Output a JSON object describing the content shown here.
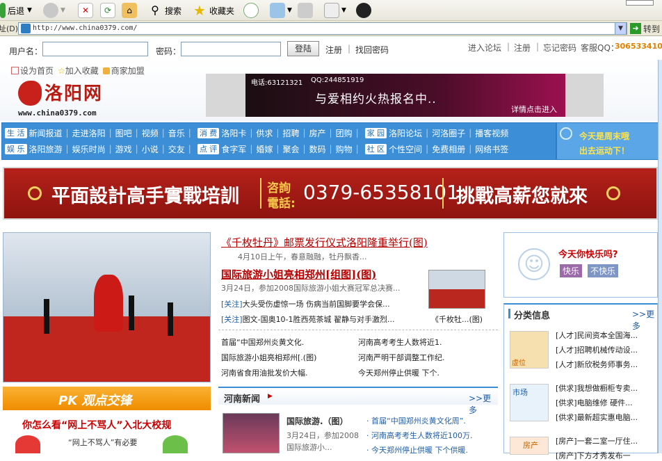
{
  "browser": {
    "back_label": "后退",
    "search_label": "搜索",
    "favorites_label": "收藏夹",
    "address_label": "址(D)",
    "url": "http://www.china0379.com/",
    "go_label": "转到"
  },
  "login": {
    "username_label": "用户名：",
    "password_label": "密码：",
    "login_button": "登陆",
    "register": "注册",
    "find_password": "找回密码",
    "forum": "进入论坛",
    "register2": "注册",
    "forgot": "忘记密码",
    "service_label": "客服QQ：",
    "service_qq": "306533410"
  },
  "header": {
    "set_home": "设为首页",
    "add_fav": "加入收藏",
    "merchant": "商家加盟",
    "logo_text": "洛阳网",
    "logo_url": "www.china0379.com",
    "ad_phone": "电话:63121321",
    "ad_qq": "QQ:244851919",
    "ad_title": "与爱相约火热报名中..",
    "ad_cta": "详情点击进入"
  },
  "nav": {
    "row1": [
      {
        "tag": "生 活",
        "links": [
          "新闻报道",
          "走进洛阳",
          "图吧",
          "视频",
          "音乐"
        ]
      },
      {
        "tag": "消 费",
        "links": [
          "洛阳卡",
          "供求",
          "招聘",
          "房产",
          "团购"
        ]
      },
      {
        "tag": "家 园",
        "links": [
          "洛阳论坛",
          "河洛圈子",
          "播客视频"
        ]
      }
    ],
    "row2": [
      {
        "tag": "娱 乐",
        "links": [
          "洛阳旅游",
          "娱乐时尚",
          "游戏",
          "小说",
          "交友"
        ]
      },
      {
        "tag": "点 评",
        "links": [
          "食字军",
          "婚嫁",
          "聚会",
          "数码",
          "购物"
        ]
      },
      {
        "tag": "社 区",
        "links": [
          "个性空间",
          "免费相册",
          "网络书签"
        ]
      }
    ],
    "weekend_line1": "今天是周末哦",
    "weekend_line2": "出去运动下！"
  },
  "red_banner": {
    "left": "平面設計高手實戰培訓",
    "consult1": "咨詢",
    "consult2": "電話:",
    "phone": "0379-65358101",
    "right": "挑戰高薪您就來"
  },
  "headline": {
    "title1": "《千枚牡丹》邮票发行仪式洛阳隆重举行(图)",
    "sub1": "4月10日上午，春意融融，牡丹飘香...",
    "title2": "国际旅游小姐亮相郑州[组图](图)",
    "sub2": "3月24日，参加2008国际旅游小姐大赛冠军总决赛...",
    "item1_tag": "[关注]",
    "item1": "大头受伤虚惊一场 伤病当前国脚要学会保...",
    "item2_tag": "[关注]",
    "item2": "图文-国奥10-1胜西苑茶城 翟静与对手激烈...",
    "thumb_caption": "《千枚牡...(图)"
  },
  "mid_list": [
    [
      "首届“中国郑州炎黄文化.",
      "河南高考考生人数将近1."
    ],
    [
      "国际旅游小姐亮相郑州[.(图)",
      "河南严明干部调整工作纪."
    ],
    [
      "河南省食用油批发价大幅.",
      "今天郑州停止供暖 下个."
    ]
  ],
  "henan": {
    "title": "河南新闻",
    "more": ">>更多",
    "feature_title": "国际旅游.（图）",
    "feature_sub1": "3月24日，参加2008",
    "feature_sub2": "国际旅游小...",
    "links": [
      "首届“中国郑州炎黄文化周”.",
      "河南高考考生人数将近100万.",
      "今天郑州停止供暖 下个供暖."
    ]
  },
  "pk": {
    "title": "PK 观点交锋",
    "question": "你怎么看“网上不骂人”入北大校规",
    "desc": "“网上不骂人”有必要"
  },
  "mood": {
    "question": "今天你快乐吗?",
    "happy": "快乐",
    "unhappy": "不快乐"
  },
  "classified": {
    "title": "分类信息",
    "more": ">>更多",
    "g1_label": "虚位",
    "group1": [
      "[人才]民间资本全国海...",
      "[人才]招聘机械传动设...",
      "[人才]新欣税务师事务..."
    ],
    "g2_label": "市场",
    "group2": [
      "[供求]我想做橱柜专卖...",
      "[供求]电脑维修 硬件...",
      "[供求]最新超实惠电脑..."
    ],
    "g3_label": "房产",
    "group3": [
      "[房产]一套二室一厅住...",
      "[房产]下方才秀发布一"
    ]
  }
}
